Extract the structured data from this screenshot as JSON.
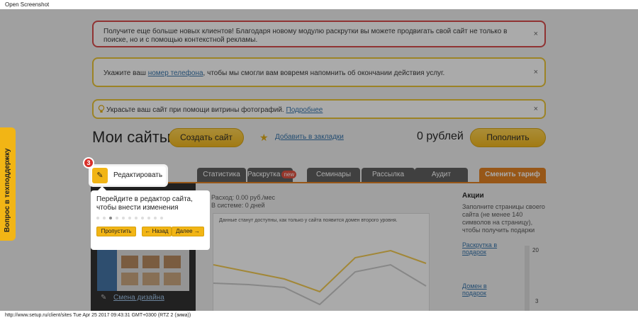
{
  "window": {
    "title": "Open Screenshot"
  },
  "status_bar": {
    "text": "http://www.setup.ru/client/sites Tue Apr 25 2017 09:43:31 GMT+0300 (RTZ 2 (зима))"
  },
  "notices": {
    "promo": "Получите еще больше новых клиентов! Благодаря новому модулю раскрутки вы можете продвигать свой сайт не только в поиске, но и с помощью контекстной рекламы.",
    "phone_before": "Укажите ваш ",
    "phone_link": "номер телефона",
    "phone_after": ", чтобы мы смогли вам вовремя напомнить об окончании действия услуг.",
    "photo_text": "Украсьте ваш сайт при помощи витрины фотографий.",
    "photo_link": "Подробнее",
    "close_icon": "×"
  },
  "header": {
    "title": "Мои сайты",
    "create_button": "Создать сайт",
    "bookmark_link": "Добавить в закладки",
    "balance": "0 рублей",
    "topup_button": "Пополнить"
  },
  "tabs": {
    "stats": "Статистика",
    "promotion": "Раскрутка",
    "promotion_badge": "new",
    "seminars": "Семинары",
    "mailing": "Рассылка",
    "audit": "Аудит",
    "change_tariff": "Сменить тариф"
  },
  "site": {
    "expense": "Расход: 0.00 руб./мес",
    "in_system": "В системе: 0 дней",
    "chart_note": "Данные станут доступны, как только у сайта появится домен второго уровня.",
    "design_link": "Смена дизайна"
  },
  "aside": {
    "title": "Акции",
    "text": "Заполните страницы своего сайта (не менее 140 символов на страницу), чтобы получить подарки",
    "gift1": "Раскрутка в подарок",
    "gift2": "Домен в подарок",
    "count1": "20",
    "count2": "3"
  },
  "support": {
    "label": "Вопрос в техподдержку"
  },
  "tour": {
    "step_number": "3",
    "edit_button": "Редактировать",
    "text": "Перейдите в редактор сайта, чтобы внести изменения",
    "skip": "Пропустить",
    "back": "← Назад",
    "next": "Далее →",
    "total_steps": 11,
    "current_step": 3
  },
  "colors": {
    "accent": "#f2b515",
    "tariff": "#e27d1b",
    "alert": "#d64545"
  }
}
